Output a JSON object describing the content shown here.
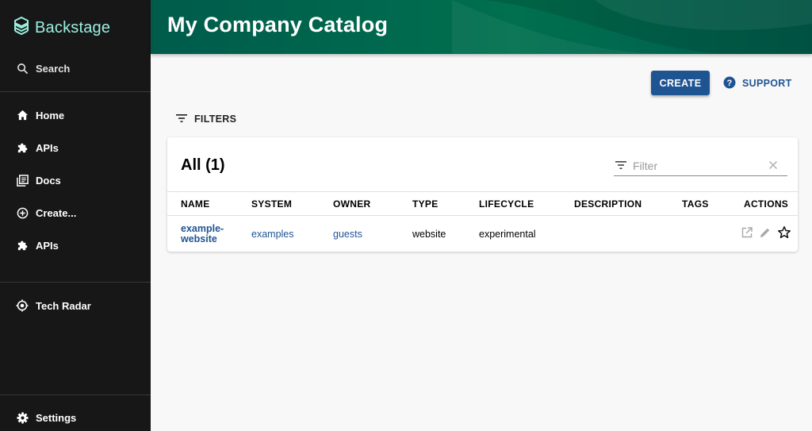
{
  "app": {
    "logo_text": "Backstage",
    "brand_color": "#9bf0e1",
    "accent_color": "#1f5493",
    "header_color": "#00704f"
  },
  "sidebar": {
    "search_label": "Search",
    "items": [
      {
        "label": "Home",
        "icon": "home-icon"
      },
      {
        "label": "APIs",
        "icon": "puzzle-icon"
      },
      {
        "label": "Docs",
        "icon": "docs-icon"
      },
      {
        "label": "Create...",
        "icon": "add-circle-icon"
      },
      {
        "label": "APIs",
        "icon": "puzzle-icon"
      }
    ],
    "tech_radar_label": "Tech Radar",
    "settings_label": "Settings"
  },
  "header": {
    "title": "My Company Catalog"
  },
  "toolbar": {
    "create_label": "CREATE",
    "support_label": "SUPPORT",
    "filters_label": "FILTERS"
  },
  "table": {
    "title": "All (1)",
    "filter_placeholder": "Filter",
    "columns": [
      "NAME",
      "SYSTEM",
      "OWNER",
      "TYPE",
      "LIFECYCLE",
      "DESCRIPTION",
      "TAGS",
      "ACTIONS"
    ],
    "rows": [
      {
        "name_line1": "example-",
        "name_line2": "website",
        "system": "examples",
        "owner": "guests",
        "type": "website",
        "lifecycle": "experimental",
        "description": "",
        "tags": ""
      }
    ]
  }
}
